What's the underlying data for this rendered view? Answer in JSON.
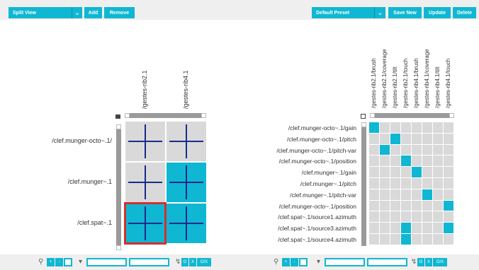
{
  "toolbar": {
    "view_select": "Split View",
    "add_label": "Add",
    "remove_label": "Remove",
    "preset_select": "Default Preset",
    "save_new_label": "Save New",
    "update_label": "Update",
    "delete_label": "Delete"
  },
  "left_matrix": {
    "columns": [
      "/gestes-rib2.1",
      "/gestes-rib4.1"
    ],
    "rows": [
      "/clef.munger-octo~.1/",
      "/clef.munger~.1",
      "/clef.spat~.1"
    ],
    "cell_fill": [
      [
        false,
        false
      ],
      [
        false,
        true
      ],
      [
        true,
        true
      ]
    ],
    "cell_cross": [
      [
        true,
        true
      ],
      [
        true,
        true
      ],
      [
        true,
        true
      ]
    ],
    "selected": [
      2,
      0
    ]
  },
  "right_matrix": {
    "columns": [
      "/gestes-rib2.1/brush",
      "/gestes-rib2.1/coverage",
      "/gestes-rib2.1/tilt",
      "/gestes-rib2.1/touch",
      "/gestes-rib4.1/brush",
      "/gestes-rib4.1/coverage",
      "/gestes-rib4.1/tilt",
      "/gestes-rib4.1/touch"
    ],
    "rows": [
      "/clef.munger-octo~.1/gain",
      "/clef.munger-octo~.1/pitch",
      "/clef.munger-octo~.1/pitch-var",
      "/clef.munger-octo~.1/position",
      "/clef.munger~.1/gain",
      "/clef.munger~.1/pitch",
      "/clef.munger~.1/pitch-var",
      "/clef.munger-octo~.1/position",
      "/clef.spat~.1/source1.azimuth",
      "/clef.spat~.1/source3.azimuth",
      "/clef.spat~.1/source4.azimuth"
    ],
    "active": [
      [
        0,
        0
      ],
      [
        1,
        2
      ],
      [
        2,
        1
      ],
      [
        3,
        3
      ],
      [
        4,
        4
      ],
      [
        6,
        5
      ],
      [
        7,
        7
      ],
      [
        9,
        3
      ],
      [
        9,
        7
      ],
      [
        10,
        3
      ]
    ]
  },
  "bottom": {
    "search_icon": "magnifier-icon",
    "filter_icon": "funnel-icon",
    "pin_icon": "pin-icon",
    "mini_left": [
      "+",
      "-"
    ],
    "mini_right": [
      "O",
      "X",
      "O/X"
    ]
  },
  "colors": {
    "accent": "#10b7d2",
    "grid_bg": "#d9d9d9",
    "cross": "#1a2a8c",
    "selection": "#d32f2f"
  }
}
